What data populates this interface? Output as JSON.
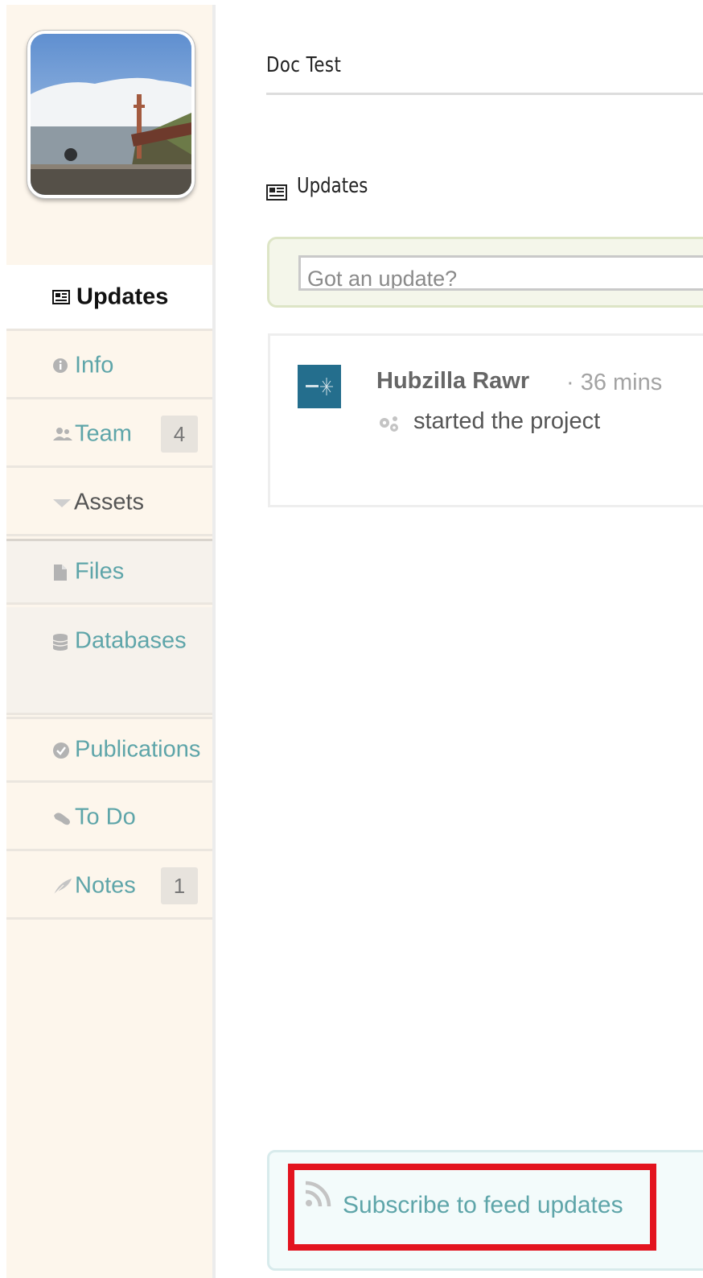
{
  "project": {
    "title": "Doc Test"
  },
  "sidebar": {
    "items": [
      {
        "label": "Updates",
        "icon": "newspaper-icon"
      },
      {
        "label": "Info",
        "icon": "info-icon"
      },
      {
        "label": "Team",
        "icon": "people-icon",
        "badge": "4"
      },
      {
        "label": "Assets",
        "icon": "triangle-down-icon"
      },
      {
        "label": "Files",
        "icon": "file-icon"
      },
      {
        "label": "Databases",
        "icon": "database-icon"
      },
      {
        "label": "Publications",
        "icon": "check-circle-icon"
      },
      {
        "label": "To Do",
        "icon": "todo-icon"
      },
      {
        "label": "Notes",
        "icon": "feather-icon",
        "badge": "1"
      }
    ]
  },
  "main": {
    "section_title": "Updates",
    "update_input": {
      "placeholder": "Got an update?"
    },
    "feed": [
      {
        "author": "Hubzilla Rawr",
        "time": "· 36 mins",
        "action": "started the project"
      }
    ],
    "subscribe": {
      "label": "Subscribe to feed updates",
      "icon": "rss-icon"
    }
  },
  "colors": {
    "link": "#5ea5a9",
    "sidebar_bg": "#fdf6ec",
    "highlight": "#e3141f",
    "feed_avatar": "#246e8d"
  }
}
